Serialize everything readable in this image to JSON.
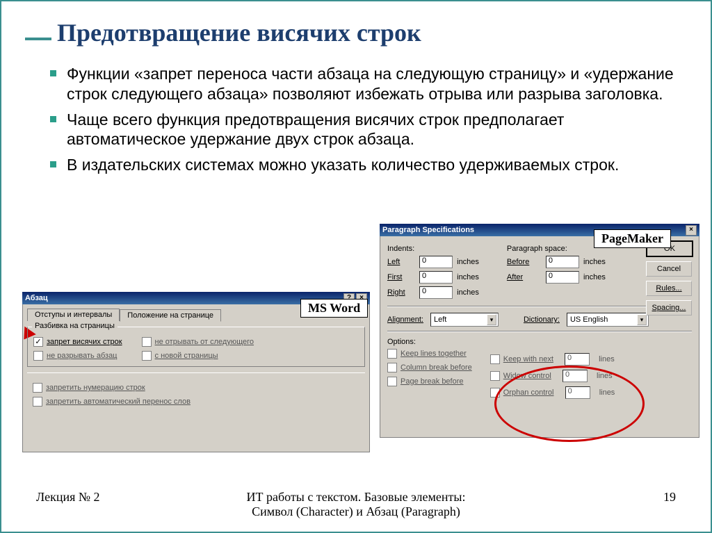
{
  "slide": {
    "title": "Предотвращение висячих строк",
    "bullets": [
      "Функции «запрет переноса части абзаца на следующую страницу» и «удержание строк следующего абзаца» позволяют избежать отрыва или разрыва заголовка.",
      "Чаще всего функция предотвращения висячих строк предполагает автоматическое удержание двух строк абзаца.",
      "В издательских системах можно указать количество удерживаемых строк."
    ]
  },
  "labels": {
    "msword": "MS Word",
    "pagemaker": "PageMaker"
  },
  "msword": {
    "title": "Абзац",
    "help_btn": "?",
    "close_btn": "×",
    "tab1": "Отступы и интервалы",
    "tab2": "Положение на странице",
    "group_pagination": "Разбивка на страницы",
    "chk_widow": "запрет висячих строк",
    "chk_keep_with_next": "не отрывать от следующего",
    "chk_keep_together": "не разрывать абзац",
    "chk_page_break": "с новой страницы",
    "chk_suppress_line_numbers": "запретить нумерацию строк",
    "chk_no_hyphenation": "запретить автоматический перенос слов"
  },
  "pagemaker": {
    "title": "Paragraph Specifications",
    "close_btn": "×",
    "section_indents": "Indents:",
    "section_space": "Paragraph space:",
    "lbl_left": "Left",
    "lbl_first": "First",
    "lbl_right": "Right",
    "lbl_before": "Before",
    "lbl_after": "After",
    "val_zero": "0",
    "unit_inches": "inches",
    "lbl_alignment": "Alignment:",
    "val_alignment": "Left",
    "lbl_dictionary": "Dictionary:",
    "val_dictionary": "US English",
    "section_options": "Options:",
    "chk_keep_lines": "Keep lines together",
    "chk_column_break": "Column break before",
    "chk_page_break": "Page break before",
    "chk_keep_next": "Keep with next",
    "chk_widow": "Widow control",
    "chk_orphan": "Orphan control",
    "unit_lines": "lines",
    "btn_ok": "OK",
    "btn_cancel": "Cancel",
    "btn_rules": "Rules...",
    "btn_spacing": "Spacing..."
  },
  "footer": {
    "left": "Лекция № 2",
    "center1": "ИТ работы с текстом. Базовые элементы:",
    "center2": "Символ (Character)  и Абзац (Paragraph)",
    "page": "19"
  }
}
